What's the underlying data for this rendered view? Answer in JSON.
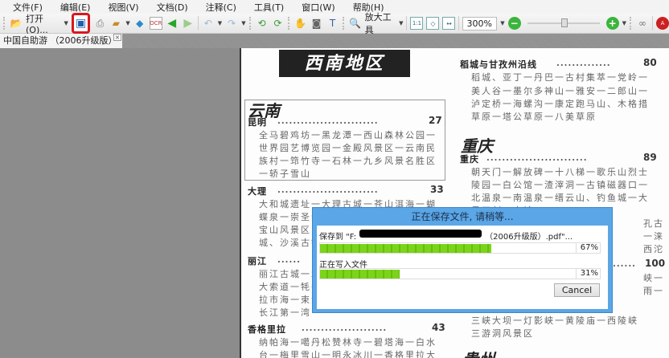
{
  "menu": [
    "文件(F)",
    "编辑(E)",
    "视图(V)",
    "文档(D)",
    "注释(C)",
    "工具(T)",
    "窗口(W)",
    "帮助(H)"
  ],
  "toolbar": {
    "open_label": "打开(O)...",
    "zoom_tool_label": "放大工具",
    "zoom_value": "300%"
  },
  "tab": {
    "title": "中国自助游 （2006升级版）*",
    "close": "×"
  },
  "document": {
    "region": "西南地区",
    "left": {
      "province": "云南",
      "sections": [
        {
          "name": "昆明",
          "dots": "..........................",
          "page": "27",
          "lines": [
            "全马碧鸡坊一黑龙潭一西山森林公园一",
            "世界园艺博览园一金殿风景区一云南民",
            "族村一筇竹寺一石林一九乡风景名胜区",
            "一轿子雪山"
          ]
        },
        {
          "name": "大理",
          "dots": "..........................",
          "page": "33",
          "lines": [
            "大和城遗址一大理古城一苍山洱海一蝴",
            "蝶泉一崇圣寺",
            "宝山风景区",
            "城、沙溪古镇"
          ]
        },
        {
          "name": "丽江",
          "dots": "......",
          "lines": [
            "丽江古城一木",
            "大索道一牦牛",
            "拉市海一束河",
            "长江第一湾"
          ]
        },
        {
          "name": "香格里拉",
          "dots": "......................",
          "page": "43",
          "lines": [
            "纳帕海一噶丹松赞林寺一碧塔海一白水",
            "台一梅里雪山一明永冰川一香格里拉大"
          ]
        }
      ]
    },
    "right": {
      "sections": [
        {
          "name": "稻城与甘孜州沿线",
          "dots": "..............",
          "page": "80",
          "lines": [
            "稻城、亚丁一丹巴一古村集萃一党岭一",
            "美人谷一墨尔多神山一雅安一二郎山一",
            "泸定桥一海螺沟一康定跑马山、木格措",
            "草原一塔公草原一八美草原"
          ]
        },
        {
          "province": "重庆",
          "name": "重庆",
          "dots": "..........................",
          "page": "89",
          "lines": [
            "朝天门一解放碑一十八梯一歌乐山烈士",
            "陵园一白公馆一渣滓洞一古镇磁器口一",
            "北温泉一南温泉一缙云山、钓鱼城一大",
            "足石刻一古镇一",
            "孔古",
            "一涞",
            "西沱"
          ]
        },
        {
          "dots": "......",
          "page": "100",
          "lines": [
            "峡一",
            "雨一",
            "三峡大坝一灯影峡一黄陵庙一西陵峡",
            "三游洞风景区"
          ]
        }
      ],
      "next_province": "贵州"
    }
  },
  "dialog": {
    "title": "正在保存文件, 请稍等...",
    "save_prefix": "保存到 \"F:",
    "save_suffix": "（2006升级版）.pdf\"...",
    "progress1_pct": 67,
    "progress1_label": "67%",
    "step_label": "正在写入文件",
    "progress2_pct": 31,
    "progress2_label": "31%",
    "cancel_label": "Cancel"
  },
  "colors": {
    "highlight": "#d9181e",
    "progress": "#7dd31a",
    "dialog_frame": "#5aa6e6"
  }
}
